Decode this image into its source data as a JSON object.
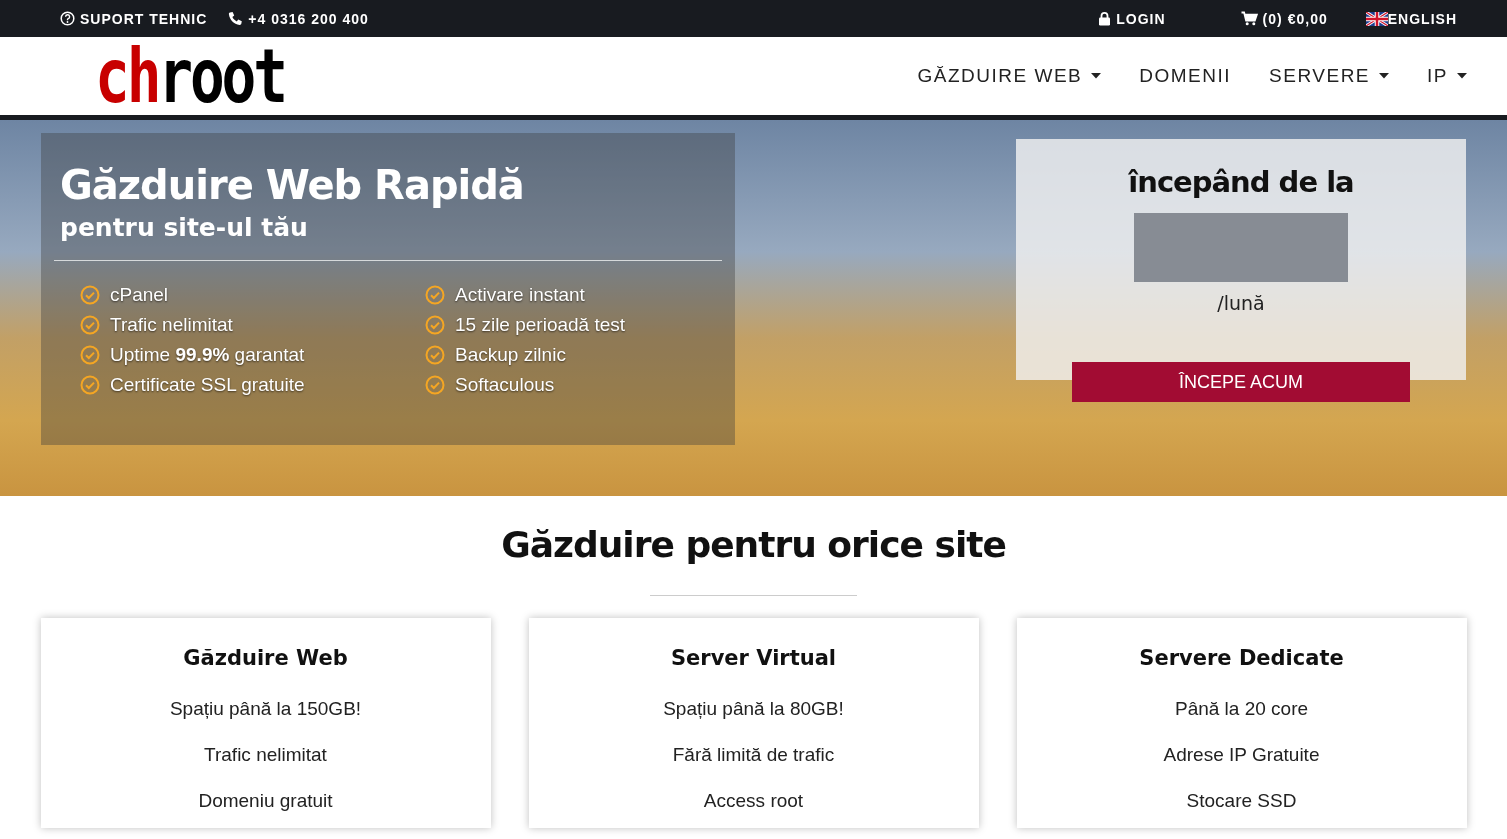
{
  "top_bar": {
    "support": "SUPORT TEHNIC",
    "phone": "+4 0316 200 400",
    "login": "LOGIN",
    "cart_count": "(0)",
    "cart_total": "€0,00",
    "language": "ENGLISH"
  },
  "logo": {
    "part_1": "ch",
    "part_2": "root"
  },
  "nav": [
    {
      "label": "GĂZDUIRE WEB",
      "dropdown": true
    },
    {
      "label": "DOMENII",
      "dropdown": false
    },
    {
      "label": "SERVERE",
      "dropdown": true
    },
    {
      "label": "IP",
      "dropdown": true
    }
  ],
  "hero": {
    "title": "Găzduire Web Rapidă",
    "subtitle": "pentru site-ul tău",
    "features": [
      {
        "text": "cPanel"
      },
      {
        "text": "Trafic nelimitat"
      },
      {
        "text": "Uptime **99.9%** garantat"
      },
      {
        "text": "Certificate SSL gratuite"
      },
      {
        "text": "Activare instant"
      },
      {
        "text": "15 zile perioadă test"
      },
      {
        "text": "Backup zilnic"
      },
      {
        "text": "Softaculous"
      }
    ],
    "price_box": {
      "heading": "începând de la",
      "period": "/lună",
      "button": "ÎNCEPE ACUM"
    }
  },
  "section": {
    "title": "Găzduire pentru orice site",
    "cards": [
      {
        "title": "Găzduire Web",
        "lines": [
          "Spațiu până la 150GB!",
          "Trafic nelimitat",
          "Domeniu gratuit"
        ]
      },
      {
        "title": "Server Virtual",
        "lines": [
          "Spațiu până la 80GB!",
          "Fără limită de trafic",
          "Access root"
        ]
      },
      {
        "title": "Servere Dedicate",
        "lines": [
          "Până la 20 core",
          "Adrese IP Gratuite",
          "Stocare SSD"
        ]
      }
    ]
  }
}
